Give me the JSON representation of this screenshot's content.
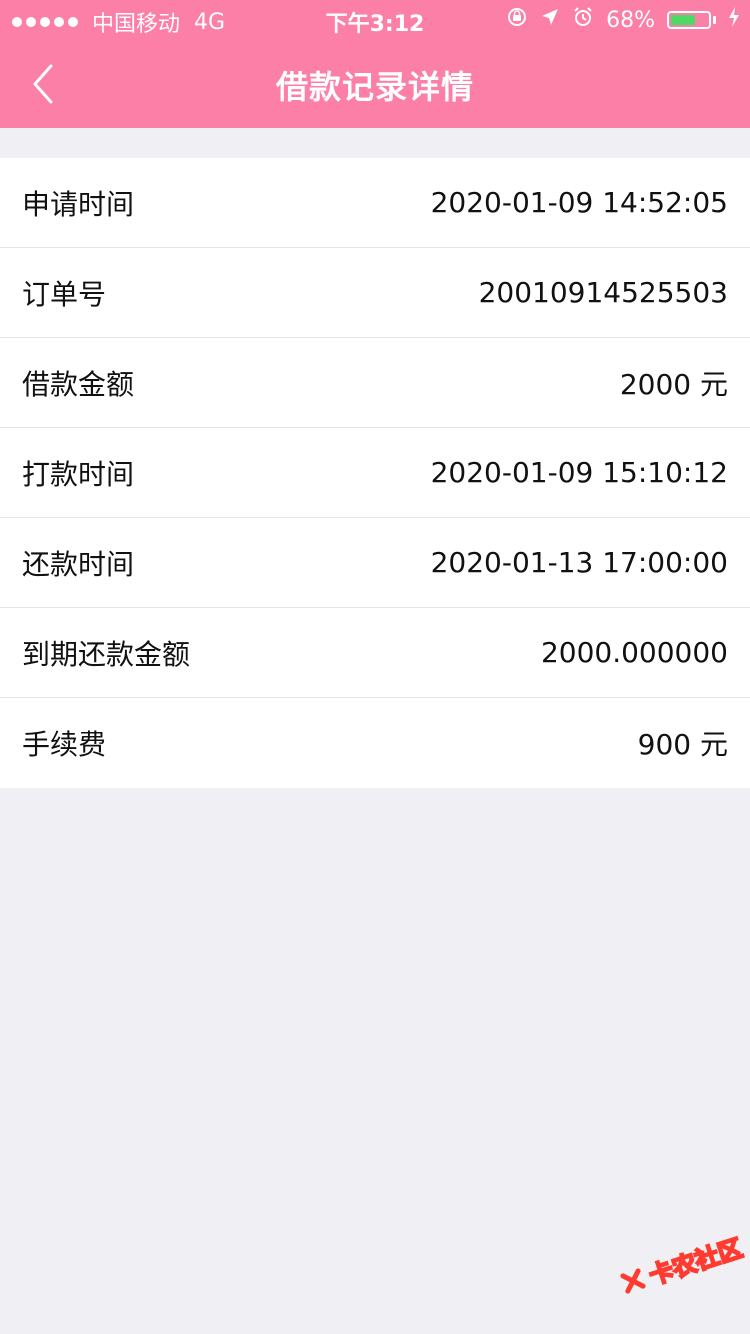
{
  "status_bar": {
    "carrier": "中国移动",
    "network": "4G",
    "time": "下午3:12",
    "battery": "68%",
    "battery_level": 0.68,
    "icons": [
      "rotation-lock-icon",
      "location-arrow-icon",
      "alarm-icon",
      "battery-icon",
      "charging-bolt-icon"
    ]
  },
  "header": {
    "title": "借款记录详情"
  },
  "details": [
    {
      "label": "申请时间",
      "value": "2020-01-09 14:52:05"
    },
    {
      "label": "订单号",
      "value": "20010914525503"
    },
    {
      "label": "借款金额",
      "value": "2000 元"
    },
    {
      "label": "打款时间",
      "value": "2020-01-09 15:10:12"
    },
    {
      "label": "还款时间",
      "value": "2020-01-13 17:00:00"
    },
    {
      "label": "到期还款金额",
      "value": "2000.000000"
    },
    {
      "label": "手续费",
      "value": "900 元"
    }
  ],
  "watermark": {
    "text": "卡农社区"
  },
  "colors": {
    "accent": "#fc7fa8",
    "background": "#efeff4",
    "battery_fill": "#4cd964",
    "watermark": "#ff3b30"
  }
}
